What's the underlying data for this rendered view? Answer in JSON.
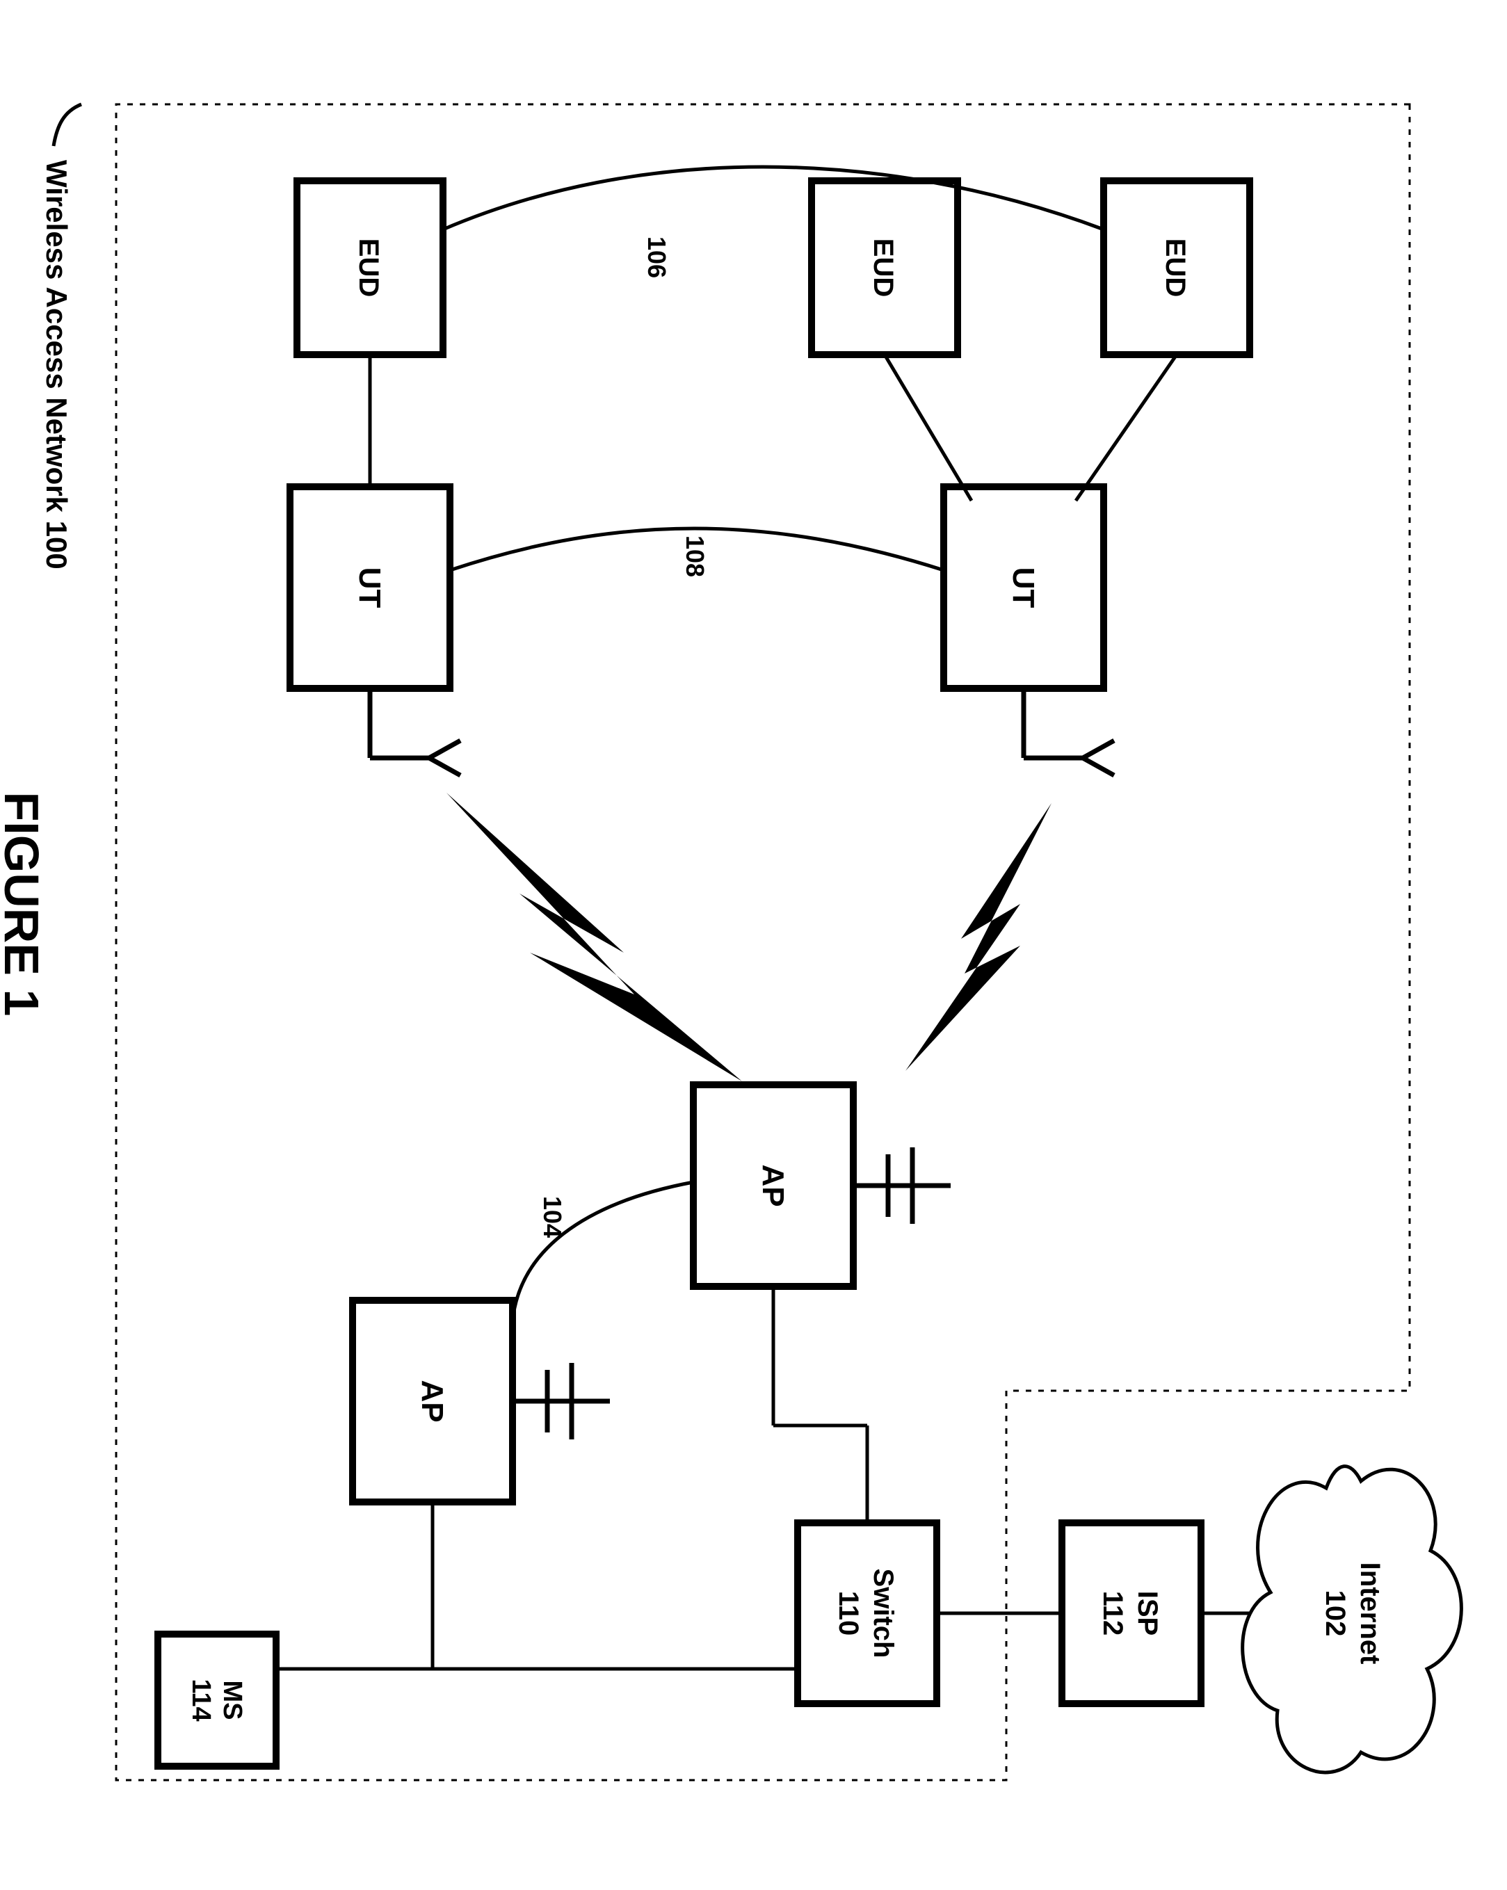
{
  "title": "FIGURE 1",
  "network_label": "Wireless Access Network 100",
  "cloud": {
    "l1": "Internet",
    "l2": "102"
  },
  "isp": {
    "l1": "ISP",
    "l2": "112"
  },
  "switch": {
    "l1": "Switch",
    "l2": "110"
  },
  "ms": {
    "l1": "MS",
    "l2": "114"
  },
  "ap1": {
    "l1": "AP"
  },
  "ap2": {
    "l1": "AP"
  },
  "ut1": {
    "l1": "UT"
  },
  "ut2": {
    "l1": "UT"
  },
  "eud1": {
    "l1": "EUD"
  },
  "eud2": {
    "l1": "EUD"
  },
  "eud3": {
    "l1": "EUD"
  },
  "ref104": "104",
  "ref106": "106",
  "ref108": "108"
}
